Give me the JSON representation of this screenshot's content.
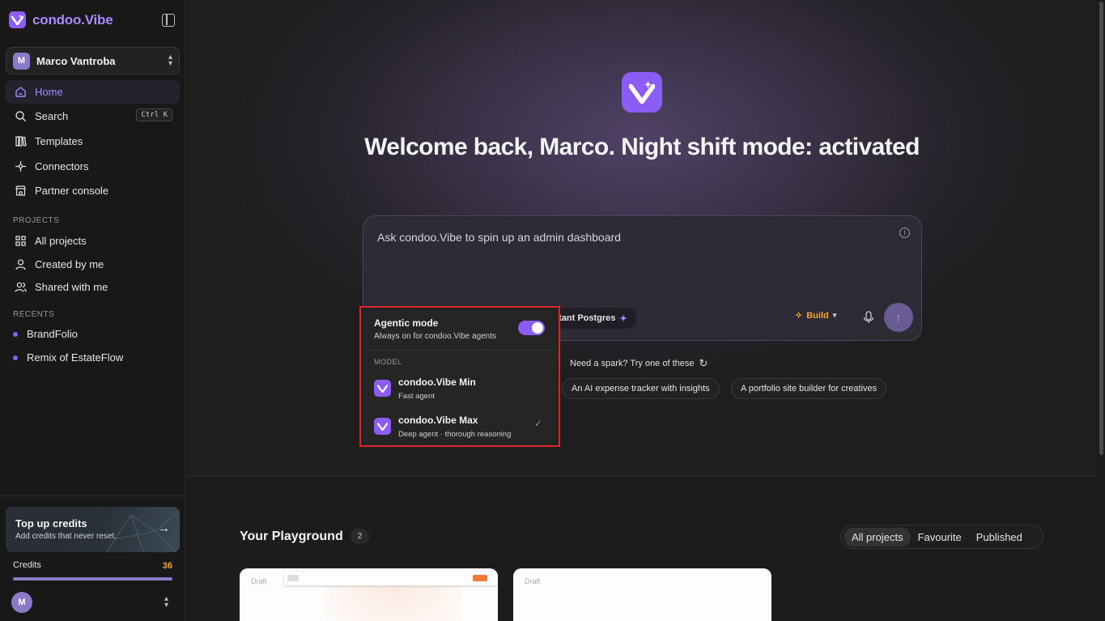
{
  "brand": {
    "name": "condoo.Vibe"
  },
  "workspace": {
    "initial": "M",
    "name": "Marco Vantroba"
  },
  "nav": [
    {
      "label": "Home",
      "icon": "home-icon"
    },
    {
      "label": "Search",
      "icon": "search-icon",
      "shortcut": "Ctrl K"
    },
    {
      "label": "Templates",
      "icon": "templates-icon"
    },
    {
      "label": "Connectors",
      "icon": "connectors-icon"
    },
    {
      "label": "Partner console",
      "icon": "store-icon"
    }
  ],
  "projects_section": {
    "label": "PROJECTS",
    "items": [
      {
        "label": "All projects",
        "icon": "grid-icon"
      },
      {
        "label": "Created by me",
        "icon": "user-icon"
      },
      {
        "label": "Shared with me",
        "icon": "users-icon"
      }
    ]
  },
  "recents_section": {
    "label": "RECENTS",
    "items": [
      "BrandFolio",
      "Remix of EstateFlow"
    ]
  },
  "topup": {
    "title": "Top up credits",
    "subtitle": "Add credits that never reset."
  },
  "credits": {
    "label": "Credits",
    "value": "36",
    "fill_fraction": 1.0
  },
  "user": {
    "initial": "M"
  },
  "hero": {
    "title": "Welcome back, Marco. Night shift mode: activated"
  },
  "prompt": {
    "text": "Ask condoo.Vibe to spin up an admin dashboard",
    "postgres_chip": "stant Postgres",
    "build_label": "Build"
  },
  "spark": {
    "label": "Need a spark? Try one of these",
    "suggestions": [
      "An AI expense tracker with insights",
      "A portfolio site builder for creatives"
    ]
  },
  "playground": {
    "title": "Your Playground",
    "count": "2",
    "filters": [
      "All projects",
      "Favourite",
      "Published"
    ],
    "selected_filter": "All projects",
    "cards": [
      {
        "badge": "Draft"
      },
      {
        "badge": "Draft"
      }
    ]
  },
  "popup": {
    "agentic_title": "Agentic mode",
    "agentic_sub": "Always on for condoo.Vibe agents",
    "agentic_on": true,
    "model_label": "MODEL",
    "models": [
      {
        "name": "condoo.Vibe Min",
        "desc": "Fast agent",
        "selected": false
      },
      {
        "name": "condoo.Vibe Max",
        "desc": "Deep agent · thorough reasoning",
        "selected": true
      }
    ]
  },
  "colors": {
    "accent": "#8b5cf6",
    "highlight_box": "#e0242b",
    "credits_value": "#f5a623"
  }
}
